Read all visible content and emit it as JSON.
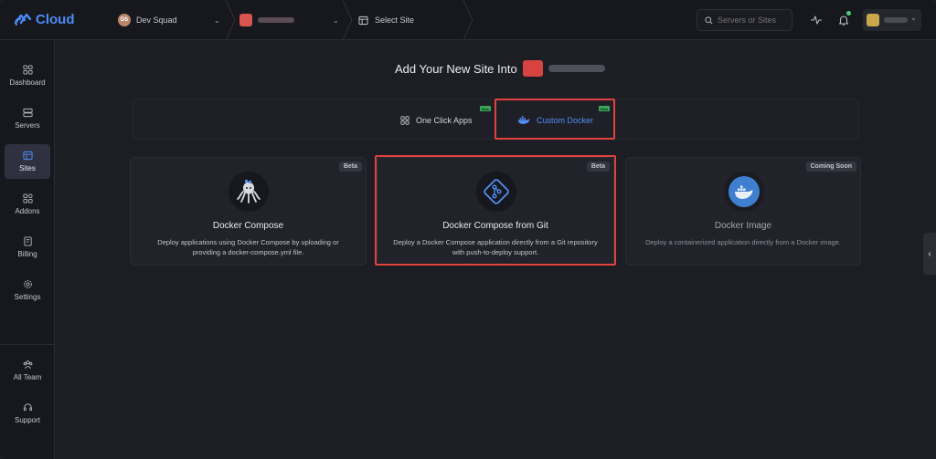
{
  "brand": {
    "name": "Cloud",
    "accent": "#4b8bf5"
  },
  "header": {
    "team": {
      "initials": "DS",
      "name": "Dev Squad"
    },
    "site_selector": {
      "label": "Select Site"
    },
    "search": {
      "placeholder": "Servers or Sites"
    },
    "icons": [
      "activity-icon",
      "bell-icon"
    ]
  },
  "sidebar": {
    "items": [
      {
        "label": "Dashboard",
        "icon": "grid-icon"
      },
      {
        "label": "Servers",
        "icon": "server-icon"
      },
      {
        "label": "Sites",
        "icon": "browser-icon",
        "active": true
      },
      {
        "label": "Addons",
        "icon": "addons-icon"
      },
      {
        "label": "Billing",
        "icon": "billing-icon"
      },
      {
        "label": "Settings",
        "icon": "gear-icon"
      }
    ],
    "bottom_items": [
      {
        "label": "All Team",
        "icon": "team-icon"
      },
      {
        "label": "Support",
        "icon": "headset-icon"
      }
    ]
  },
  "main": {
    "title": "Add Your New Site Into",
    "tabs": [
      {
        "label": "One Click Apps",
        "badge": "New",
        "icon": "grid-icon"
      },
      {
        "label": "Custom Docker",
        "badge": "New",
        "icon": "docker-icon",
        "active": true
      }
    ],
    "cards": [
      {
        "title": "Docker Compose",
        "badge": "Beta",
        "description": "Deploy applications using Docker Compose by uploading or providing a docker-compose.yml file.",
        "icon": "octopus-icon"
      },
      {
        "title": "Docker Compose from Git",
        "badge": "Beta",
        "description": "Deploy a Docker Compose application directly from a Git repository with push-to-deploy support.",
        "icon": "git-icon"
      },
      {
        "title": "Docker Image",
        "badge": "Coming Soon",
        "description": "Deploy a containerized application directly from a Docker image.",
        "icon": "docker-icon"
      }
    ]
  },
  "colors": {
    "highlight": "#e0423e",
    "active_tab": "#4f8ff7",
    "new_badge": "#3aa659"
  }
}
